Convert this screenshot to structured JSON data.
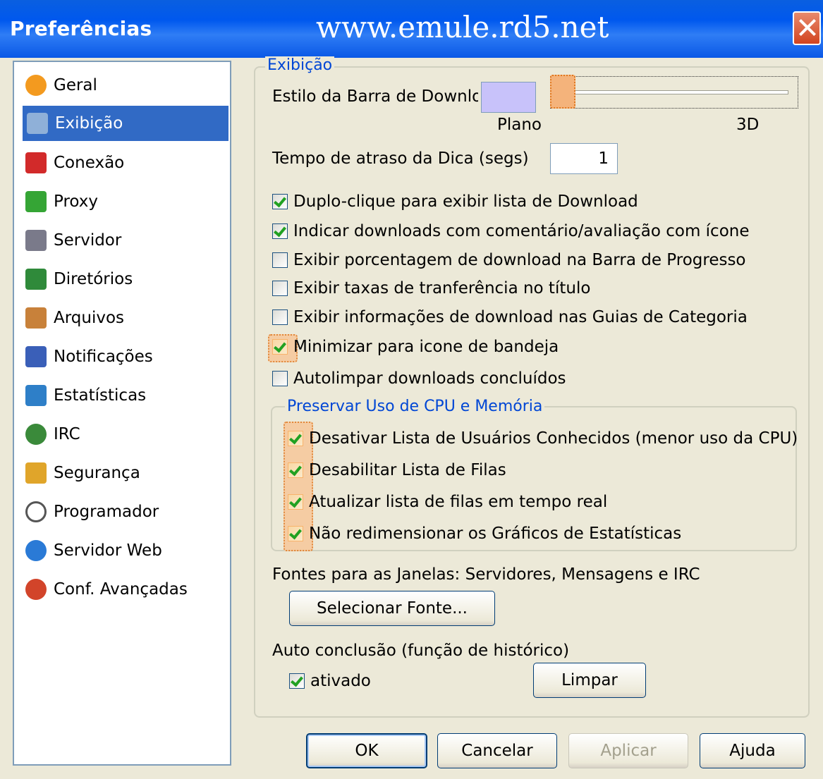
{
  "window": {
    "title": "Preferências",
    "url_banner": "www.emule.rd5.net"
  },
  "nav": {
    "items": [
      {
        "label": "Geral",
        "icon": "gear-icon",
        "color": "#f39a1f"
      },
      {
        "label": "Exibição",
        "icon": "display-icon",
        "color": "#8fb0d8"
      },
      {
        "label": "Conexão",
        "icon": "plug-icon",
        "color": "#d22a2a"
      },
      {
        "label": "Proxy",
        "icon": "proxy-icon",
        "color": "#35a535"
      },
      {
        "label": "Servidor",
        "icon": "server-icon",
        "color": "#7a7a8a"
      },
      {
        "label": "Diretórios",
        "icon": "folder-icon",
        "color": "#2f8a3a"
      },
      {
        "label": "Arquivos",
        "icon": "files-icon",
        "color": "#c8813a"
      },
      {
        "label": "Notificações",
        "icon": "notification-icon",
        "color": "#3a5fb8"
      },
      {
        "label": "Estatísticas",
        "icon": "statistics-icon",
        "color": "#2e7fc8"
      },
      {
        "label": "IRC",
        "icon": "irc-icon",
        "color": "#3a8a3a"
      },
      {
        "label": "Segurança",
        "icon": "lock-icon",
        "color": "#e0a52a"
      },
      {
        "label": "Programador",
        "icon": "clock-icon",
        "color": "#555555"
      },
      {
        "label": "Servidor Web",
        "icon": "globe-icon",
        "color": "#2a7ad6"
      },
      {
        "label": "Conf. Avançadas",
        "icon": "advanced-icon",
        "color": "#d2442a"
      }
    ],
    "selected": "Exibição"
  },
  "display": {
    "group_title": "Exibição",
    "download_bar_style_label": "Estilo da Barra de Downloa",
    "bar_color": "#c8c2fa",
    "slider_min_label": "Plano",
    "slider_max_label": "3D",
    "slider_value": 0,
    "tooltip_delay_label": "Tempo de atraso da Dica (segs)",
    "tooltip_delay_value": "1"
  },
  "options": [
    {
      "label": "Duplo-clique para exibir lista de Download",
      "checked": true
    },
    {
      "label": "Indicar downloads com comentário/avaliação com ícone",
      "checked": true
    },
    {
      "label": "Exibir porcentagem de download na Barra de Progresso",
      "checked": false
    },
    {
      "label": "Exibir taxas de tranferência no título",
      "checked": false
    },
    {
      "label": "Exibir informações de download nas Guias de Categoria",
      "checked": false
    },
    {
      "label": "Minimizar para icone de bandeja",
      "checked": true
    },
    {
      "label": "Autolimpar downloads concluídos",
      "checked": false
    }
  ],
  "cpu": {
    "group_title": "Preservar Uso de CPU e Memória",
    "options": [
      {
        "label": "Desativar Lista de Usuários Conhecidos (menor uso da CPU)",
        "checked": true
      },
      {
        "label": "Desabilitar Lista de Filas",
        "checked": true
      },
      {
        "label": "Atualizar lista de filas em tempo real",
        "checked": true
      },
      {
        "label": "Não redimensionar os Gráficos de Estatísticas",
        "checked": true
      }
    ]
  },
  "fonts": {
    "label": "Fontes para as Janelas: Servidores, Mensagens e IRC",
    "select_button": "Selecionar Fonte..."
  },
  "autocomplete": {
    "label": "Auto conclusão (função de histórico)",
    "enabled_label": "ativado",
    "enabled": true,
    "clear_button": "Limpar"
  },
  "buttons": {
    "ok": "OK",
    "cancel": "Cancelar",
    "apply": "Aplicar",
    "help": "Ajuda"
  }
}
